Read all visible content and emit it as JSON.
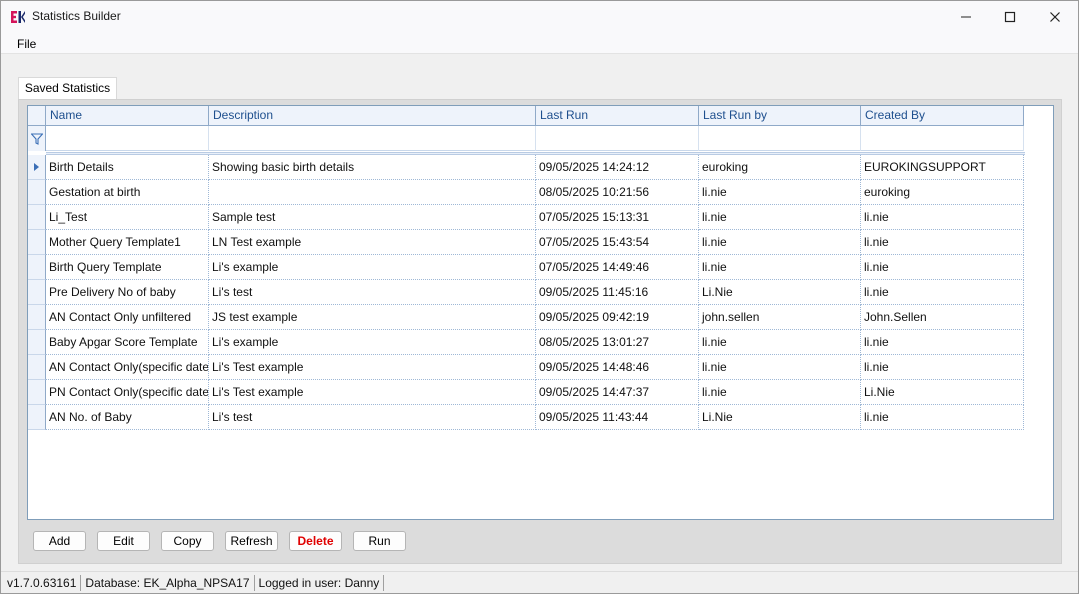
{
  "window": {
    "title": "Statistics Builder",
    "logo": "EK"
  },
  "menu": {
    "file": "File"
  },
  "tabs": [
    {
      "label": "Saved Statistics"
    }
  ],
  "grid": {
    "columns": [
      "Name",
      "Description",
      "Last Run",
      "Last Run by",
      "Created By"
    ],
    "rows": [
      [
        "Birth Details",
        "Showing basic birth details",
        "09/05/2025 14:24:12",
        "euroking",
        "EUROKINGSUPPORT"
      ],
      [
        "Gestation at birth",
        "",
        "08/05/2025 10:21:56",
        "li.nie",
        "euroking"
      ],
      [
        "Li_Test",
        "Sample test",
        "07/05/2025 15:13:31",
        "li.nie",
        "li.nie"
      ],
      [
        "Mother Query Template1",
        "LN Test example",
        "07/05/2025 15:43:54",
        "li.nie",
        "li.nie"
      ],
      [
        "Birth Query Template",
        "Li's example",
        "07/05/2025 14:49:46",
        "li.nie",
        "li.nie"
      ],
      [
        "Pre Delivery No of baby",
        "Li's test",
        "09/05/2025 11:45:16",
        "Li.Nie",
        "li.nie"
      ],
      [
        "AN Contact Only unfiltered",
        "JS test example",
        "09/05/2025 09:42:19",
        "john.sellen",
        "John.Sellen"
      ],
      [
        "Baby Apgar Score Template",
        "Li's example",
        "08/05/2025 13:01:27",
        "li.nie",
        "li.nie"
      ],
      [
        "AN Contact Only(specific date)",
        "Li's Test example",
        "09/05/2025 14:48:46",
        "li.nie",
        "li.nie"
      ],
      [
        "PN Contact Only(specific date)",
        "Li's Test example",
        "09/05/2025 14:47:37",
        "li.nie",
        "Li.Nie"
      ],
      [
        "AN No. of Baby",
        "Li's test",
        "09/05/2025 11:43:44",
        "Li.Nie",
        "li.nie"
      ]
    ]
  },
  "buttons": {
    "add": "Add",
    "edit": "Edit",
    "copy": "Copy",
    "refresh": "Refresh",
    "delete": "Delete",
    "run": "Run"
  },
  "status": {
    "version": "v1.7.0.63161",
    "database": "Database: EK_Alpha_NPSA17",
    "user": "Logged in user: Danny"
  },
  "colors": {
    "header_text": "#1e4f8e",
    "delete_text": "#e00000",
    "logo_pink": "#d4145a",
    "logo_navy": "#1b2a6b"
  }
}
